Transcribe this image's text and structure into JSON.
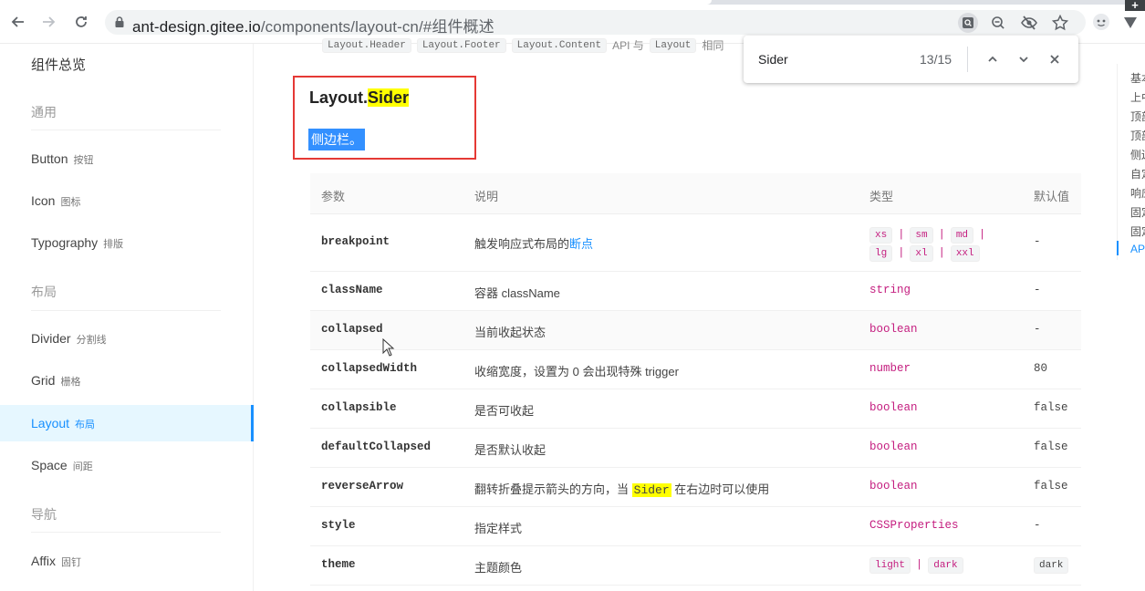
{
  "browser": {
    "url_host": "ant-design.gitee.io",
    "url_path": "/components/layout-cn/#组件概述",
    "icons": [
      "back-icon",
      "forward-icon",
      "reload-icon",
      "lock-icon",
      "find-icon",
      "zoom-icon",
      "eye-off-icon",
      "star-icon",
      "profile-icon",
      "extension-icon"
    ]
  },
  "sidebar": {
    "overview": "组件总览",
    "groups": {
      "general": "通用",
      "layout": "布局",
      "navigation": "导航"
    },
    "items": [
      {
        "label": "Button",
        "sub": "按钮"
      },
      {
        "label": "Icon",
        "sub": "图标"
      },
      {
        "label": "Typography",
        "sub": "排版"
      },
      {
        "label": "Divider",
        "sub": "分割线"
      },
      {
        "label": "Grid",
        "sub": "栅格"
      },
      {
        "label": "Layout",
        "sub": "布局"
      },
      {
        "label": "Space",
        "sub": "间距"
      },
      {
        "label": "Affix",
        "sub": "固钉"
      }
    ]
  },
  "intro": {
    "chips": [
      "Layout.Header",
      "Layout.Footer",
      "Layout.Content"
    ],
    "text_mid": "API 与",
    "chip_last": "Layout",
    "text_end": "相同"
  },
  "section": {
    "title_prefix": "Layout.",
    "title_highlight": "Sider",
    "description": "侧边栏。"
  },
  "table": {
    "headers": {
      "param": "参数",
      "desc": "说明",
      "type": "类型",
      "default": "默认值"
    },
    "breakpoint": {
      "param": "breakpoint",
      "desc_text": "触发响应式布局的",
      "desc_link": "断点",
      "type_chips": [
        "xs",
        "sm",
        "md",
        "lg",
        "xl",
        "xxl"
      ],
      "default": "-"
    },
    "rows": [
      {
        "param": "className",
        "desc": "容器 className",
        "type": "string",
        "default": "-"
      },
      {
        "param": "collapsed",
        "desc": "当前收起状态",
        "type": "boolean",
        "default": "-"
      },
      {
        "param": "collapsedWidth",
        "desc": "收缩宽度，设置为 0 会出现特殊 trigger",
        "type": "number",
        "default": "80"
      },
      {
        "param": "collapsible",
        "desc": "是否可收起",
        "type": "boolean",
        "default": "false"
      },
      {
        "param": "defaultCollapsed",
        "desc": "是否默认收起",
        "type": "boolean",
        "default": "false"
      },
      {
        "param": "style",
        "desc": "指定样式",
        "type": "CSSProperties",
        "default": "-"
      }
    ],
    "reverseArrow": {
      "param": "reverseArrow",
      "desc_before": "翻转折叠提示箭头的方向，当",
      "desc_highlight": "Sider",
      "desc_after": "在右边时可以使用",
      "type": "boolean",
      "default": "false"
    },
    "theme": {
      "param": "theme",
      "desc": "主题颜色",
      "type_chips": [
        "light",
        "dark"
      ],
      "default": "dark"
    }
  },
  "find": {
    "query": "Sider",
    "count": "13/15"
  },
  "anchor": {
    "items": [
      "基本",
      "上中",
      "顶部",
      "顶部",
      "侧边",
      "自定",
      "响应",
      "固定",
      "固定",
      "API"
    ]
  },
  "colors": {
    "accent": "#1890ff",
    "code_type": "#c41d7f",
    "highlight": "#ffff00",
    "selection": "#3390ff",
    "annotation_box": "#e53935"
  }
}
